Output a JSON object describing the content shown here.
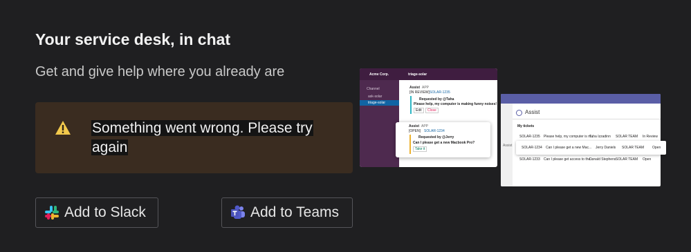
{
  "heading": "Your service desk, in chat",
  "subheading": "Get and give help where you already are",
  "alert": {
    "message": "Something went wrong. Please try again",
    "icon": "warning-icon",
    "color": "#f2c94c"
  },
  "buttons": {
    "slack": "Add to Slack",
    "teams": "Add to Teams"
  },
  "slack_mock": {
    "workspace": "Acme Corp.",
    "channel": "triage-solar",
    "sidebar_header": "Channel",
    "sidebar_items": [
      "ask-solar",
      "triage-solar"
    ],
    "message1": {
      "sender": "Assist",
      "app_tag": "APP",
      "status": "[IN REVIEW]",
      "ticket": "SOLAR-1235",
      "requested_by": "Requested by @Taha",
      "body": "Please help, my computer is making funny noises!",
      "actions": [
        "Edit",
        "Close"
      ]
    },
    "message2": {
      "sender": "Assist",
      "app_tag": "APP",
      "status": "[OPEN]",
      "ticket": "SOLAR-1234",
      "requested_by": "Requested by @Jerry",
      "body": "Can I please get a new Macbook Pro?",
      "action": "Take it"
    }
  },
  "teams_mock": {
    "app_name": "Assist",
    "rail_label": "Assist",
    "section": "My tickets",
    "rows": [
      {
        "id": "SOLAR-1235",
        "summary": "Please help, my computer is m...",
        "assignee": "Taha Izzadinn",
        "team": "SOLAR TEAM",
        "status": "In Review",
        "status_color": "#2aa1d6"
      },
      {
        "id": "SOLAR-1234",
        "summary": "Can I please get a new Mac...",
        "assignee": "Jerry Daniels",
        "team": "SOLAR TEAM",
        "status": "Open",
        "status_color": "#e8912d"
      },
      {
        "id": "SOLAR-1233",
        "summary": "Can I please get access to the...",
        "assignee": "Donald Stephens",
        "team": "SOLAR TEAM",
        "status": "Open",
        "status_color": "#e8912d"
      }
    ]
  }
}
